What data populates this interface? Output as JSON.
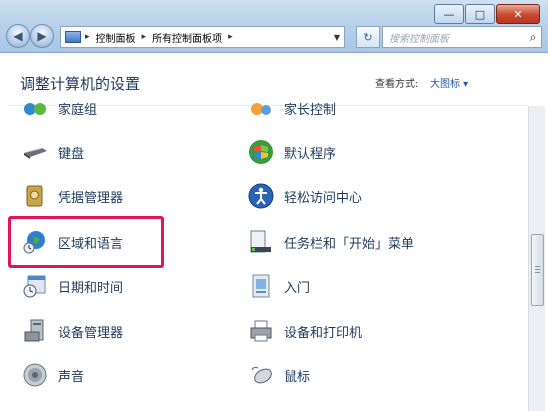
{
  "window": {
    "controls": {
      "minimize": "—",
      "maximize": "□",
      "close": "✕"
    }
  },
  "nav": {
    "back_icon": "back-arrow-icon",
    "forward_icon": "forward-arrow-icon"
  },
  "address": {
    "crumbs": [
      "控制面板",
      "所有控制面板项"
    ]
  },
  "search": {
    "placeholder": "搜索控制面板"
  },
  "header": {
    "title": "调整计算机的设置",
    "view_label": "查看方式:",
    "view_value": "大图标 ▾"
  },
  "items_left": [
    {
      "label": "家庭组",
      "icon": "homegroup-icon"
    },
    {
      "label": "键盘",
      "icon": "keyboard-icon"
    },
    {
      "label": "凭据管理器",
      "icon": "credential-manager-icon"
    },
    {
      "label": "区域和语言",
      "icon": "globe-clock-icon"
    },
    {
      "label": "日期和时间",
      "icon": "calendar-clock-icon"
    },
    {
      "label": "设备管理器",
      "icon": "device-manager-icon"
    },
    {
      "label": "声音",
      "icon": "speaker-icon"
    }
  ],
  "items_right": [
    {
      "label": "家长控制",
      "icon": "parental-controls-icon"
    },
    {
      "label": "默认程序",
      "icon": "default-programs-icon"
    },
    {
      "label": "轻松访问中心",
      "icon": "ease-of-access-icon"
    },
    {
      "label": "任务栏和「开始」菜单",
      "icon": "taskbar-icon"
    },
    {
      "label": "入门",
      "icon": "getting-started-icon"
    },
    {
      "label": "设备和打印机",
      "icon": "printer-icon"
    },
    {
      "label": "鼠标",
      "icon": "mouse-icon"
    }
  ],
  "highlight_color": "#e3155a"
}
